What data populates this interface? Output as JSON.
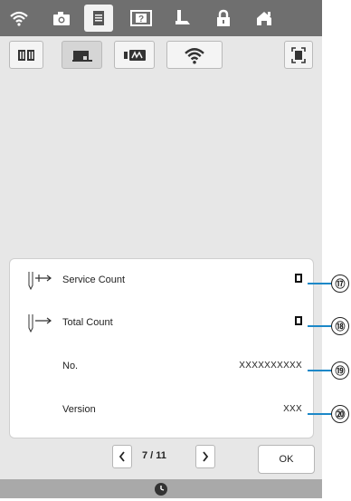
{
  "statusbar": {
    "icons": [
      "wifi-icon",
      "camera-icon",
      "document-icon",
      "help-icon",
      "presser-foot-icon",
      "lock-icon",
      "home-icon"
    ]
  },
  "tabs": {
    "items": [
      "book-icon",
      "sewing-machine-icon",
      "embroidery-icon",
      "wifi-icon"
    ],
    "selected_index": 1,
    "extra": "screenshot-icon"
  },
  "info": {
    "rows": [
      {
        "label": "Service Count",
        "value": "",
        "counter": true
      },
      {
        "label": "Total Count",
        "value": "",
        "counter": true
      },
      {
        "label": "No.",
        "value": "XXXXXXXXXX",
        "counter": false
      },
      {
        "label": "Version",
        "value": "XXX",
        "counter": false
      }
    ]
  },
  "callouts": [
    "⑰",
    "⑱",
    "⑲",
    "⑳"
  ],
  "pager": {
    "text": "7 / 11"
  },
  "ok_label": "OK",
  "colors": {
    "accent": "#1c88c8",
    "topbar": "#6f6f6f",
    "screen_bg": "#e7e7e7"
  }
}
